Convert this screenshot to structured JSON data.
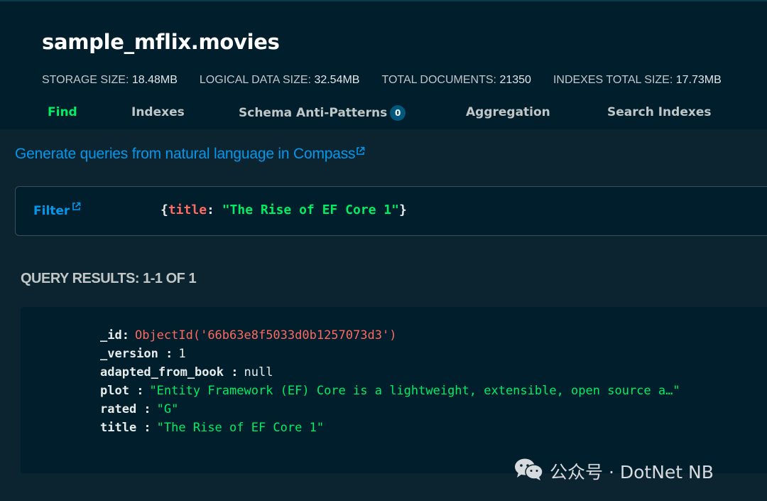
{
  "collection": {
    "title": "sample_mflix.movies"
  },
  "stats": [
    {
      "label": "STORAGE SIZE:",
      "value": "18.48MB"
    },
    {
      "label": "LOGICAL DATA SIZE:",
      "value": "32.54MB"
    },
    {
      "label": "TOTAL DOCUMENTS:",
      "value": "21350"
    },
    {
      "label": "INDEXES TOTAL SIZE:",
      "value": "17.73MB"
    }
  ],
  "tabs": [
    {
      "label": "Find",
      "active": true
    },
    {
      "label": "Indexes"
    },
    {
      "label": "Schema Anti-Patterns",
      "badge": "0"
    },
    {
      "label": "Aggregation"
    },
    {
      "label": "Search Indexes"
    }
  ],
  "compass_link": {
    "text": "Generate queries from natural language in Compass",
    "icon": "external-link-icon"
  },
  "filter": {
    "label": "Filter",
    "icon": "external-link-icon",
    "query": {
      "open": "{",
      "key": "title",
      "colon": ": ",
      "value": "\"The Rise of EF Core 1\"",
      "close": "}"
    }
  },
  "results": {
    "heading": "QUERY RESULTS: 1-1 OF 1",
    "document": [
      {
        "key": "_id",
        "colon": ":",
        "value": "ObjectId('66b63e8f5033d0b1257073d3')",
        "type": "objectid"
      },
      {
        "key": "_version",
        "colon": " :",
        "value": "1",
        "type": "number"
      },
      {
        "key": "adapted_from_book",
        "colon": " :",
        "value": "null",
        "type": "null"
      },
      {
        "key": "plot",
        "colon": " :",
        "value": "\"Entity Framework (EF) Core is a lightweight, extensible, open source a…\"",
        "type": "string"
      },
      {
        "key": "rated",
        "colon": " :",
        "value": "\"G\"",
        "type": "string"
      },
      {
        "key": "title",
        "colon": " :",
        "value": "\"The Rise of EF Core 1\"",
        "type": "string"
      }
    ]
  },
  "watermark": {
    "text": "公众号 · DotNet NB",
    "icon": "wechat-icon"
  },
  "colors": {
    "header_bg": "#001e2b",
    "content_bg": "#0c2430",
    "accent_green": "#00ed64",
    "link_blue": "#0498ec",
    "key_red": "#ff6960"
  }
}
